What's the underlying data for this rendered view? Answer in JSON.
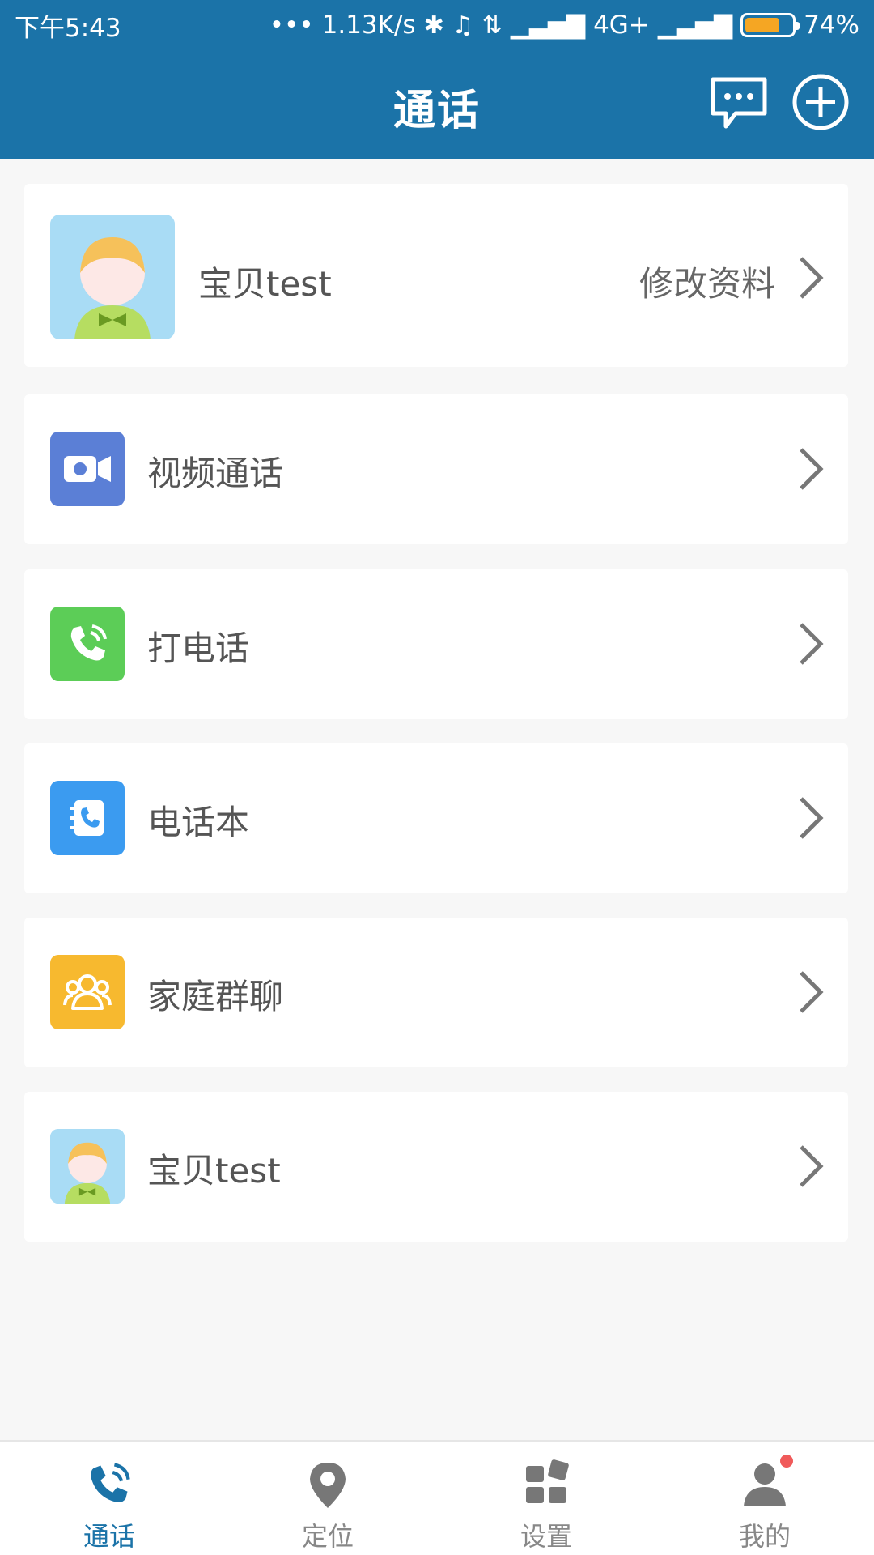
{
  "status": {
    "time": "下午5:43",
    "dots": "•••",
    "speed": "1.13K/s",
    "network": "4G+",
    "battery": "74%",
    "battery_level": 0.74
  },
  "header": {
    "title": "通话",
    "message_icon": "chat-bubble-icon",
    "add_icon": "plus-circle-icon"
  },
  "profile": {
    "name": "宝贝test",
    "edit_label": "修改资料"
  },
  "menu": [
    {
      "label": "视频通话",
      "icon": "video-camera-icon",
      "color": "#5b7fd6"
    },
    {
      "label": "打电话",
      "icon": "phone-icon",
      "color": "#5ccd57"
    },
    {
      "label": "电话本",
      "icon": "phonebook-icon",
      "color": "#3b9bf0"
    },
    {
      "label": "家庭群聊",
      "icon": "group-icon",
      "color": "#f7b92f"
    },
    {
      "label": "宝贝test",
      "icon": "child-avatar-icon",
      "color": "#a9dcf5"
    }
  ],
  "tabs": [
    {
      "label": "通话",
      "active": true
    },
    {
      "label": "定位",
      "active": false
    },
    {
      "label": "设置",
      "active": false
    },
    {
      "label": "我的",
      "active": false
    }
  ],
  "colors": {
    "accent": "#1b73a8",
    "badge": "#f05a5a"
  }
}
